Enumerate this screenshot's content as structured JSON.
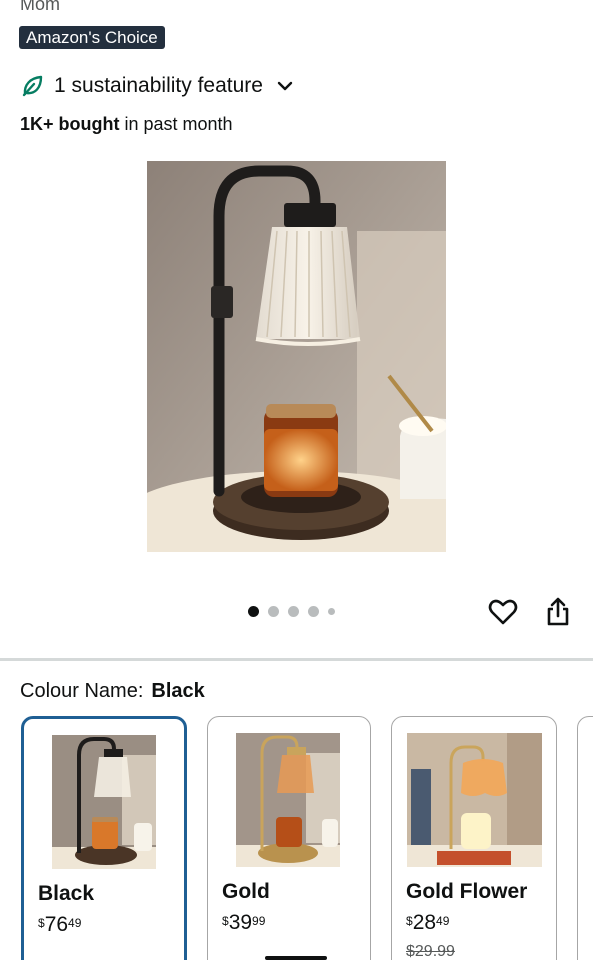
{
  "header": {
    "brand_line": "Mom",
    "badge": "Amazon's Choice",
    "sustainability": "1 sustainability feature",
    "bought_bold": "1K+ bought",
    "bought_rest": " in past month"
  },
  "gallery": {
    "dots_total": 5,
    "active_index": 0,
    "icons": [
      "heart-icon",
      "share-icon"
    ]
  },
  "colour": {
    "label": "Colour Name:",
    "selected": "Black"
  },
  "variants": [
    {
      "name": "Black",
      "currency": "$",
      "whole": "76",
      "cents": "49",
      "was": ""
    },
    {
      "name": "Gold",
      "currency": "$",
      "whole": "39",
      "cents": "99",
      "was": ""
    },
    {
      "name": "Gold Flower",
      "currency": "$",
      "whole": "28",
      "cents": "49",
      "was": "$29.99"
    }
  ],
  "colors": {
    "badge_bg": "#232f3e",
    "selected_border": "#1f5f94",
    "leaf_green": "#067d62"
  }
}
